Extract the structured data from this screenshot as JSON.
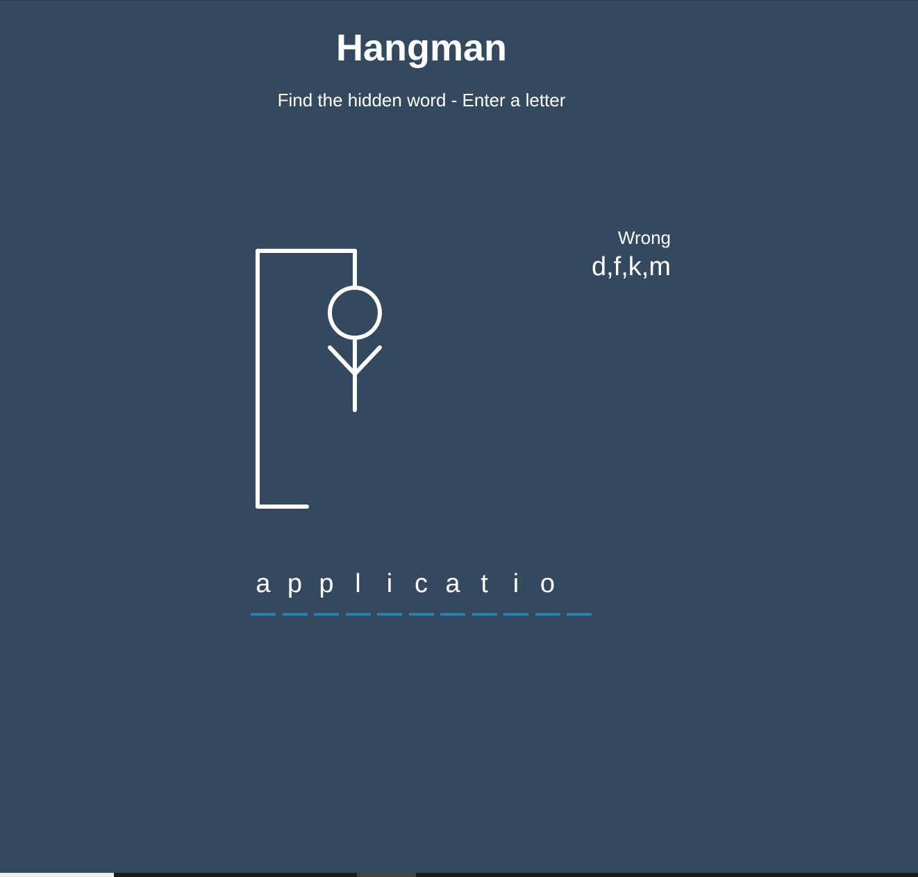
{
  "game": {
    "title": "Hangman",
    "subtitle": "Find the hidden word - Enter a letter"
  },
  "wrong": {
    "label": "Wrong",
    "letters": "d,f,k,m",
    "count": 4
  },
  "word": {
    "slots": [
      "a",
      "p",
      "p",
      "l",
      "i",
      "c",
      "a",
      "t",
      "i",
      "o",
      ""
    ]
  },
  "colors": {
    "background": "#34495e",
    "text": "#ffffff",
    "slot_underline": "#2980b9"
  },
  "hangman_parts_shown": [
    "gallows",
    "head",
    "body",
    "left-arm",
    "right-arm"
  ]
}
